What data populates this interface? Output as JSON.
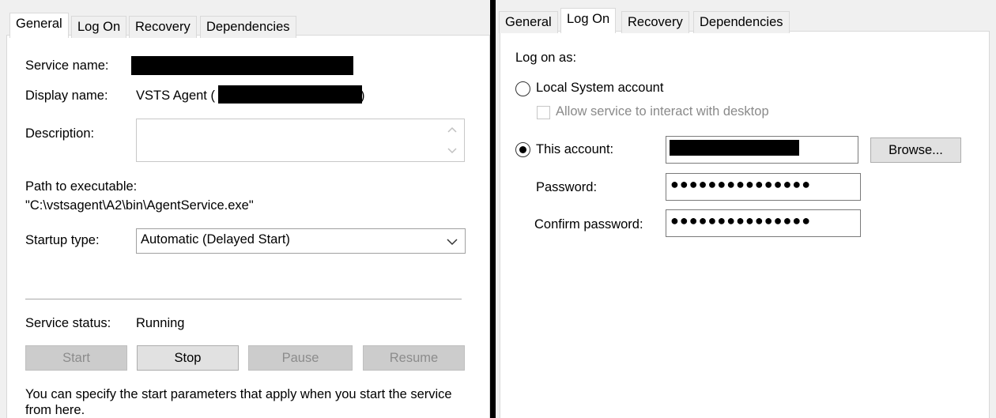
{
  "left": {
    "tabs": [
      "General",
      "Log On",
      "Recovery",
      "Dependencies"
    ],
    "service_name_label": "Service name:",
    "display_name_label": "Display name:",
    "display_name_prefix": "VSTS Agent (",
    "display_name_suffix": ")",
    "description_label": "Description:",
    "path_label": "Path to executable:",
    "path_value": "\"C:\\vstsagent\\A2\\bin\\AgentService.exe\"",
    "startup_type_label": "Startup type:",
    "startup_type_value": "Automatic (Delayed Start)",
    "service_status_label": "Service status:",
    "service_status_value": "Running",
    "buttons": {
      "start": "Start",
      "stop": "Stop",
      "pause": "Pause",
      "resume": "Resume"
    },
    "hint_line1": "You can specify the start parameters that apply when you start the service",
    "hint_line2": "from here."
  },
  "right": {
    "tabs": [
      "General",
      "Log On",
      "Recovery",
      "Dependencies"
    ],
    "log_on_as_label": "Log on as:",
    "local_system_label": "Local System account",
    "allow_interact_label": "Allow service to interact with desktop",
    "this_account_label": "This account:",
    "browse_label": "Browse...",
    "password_label": "Password:",
    "password_value": "●●●●●●●●●●●●●●●",
    "confirm_password_label": "Confirm password:",
    "confirm_password_value": "●●●●●●●●●●●●●●●",
    "selected_option": "This account",
    "allow_interact_checked": false
  },
  "colors": {
    "window_bg": "#f0f0f0",
    "tabpage_bg": "#ffffff",
    "disabled_text": "#8a8a8a",
    "redaction": "#000000"
  }
}
